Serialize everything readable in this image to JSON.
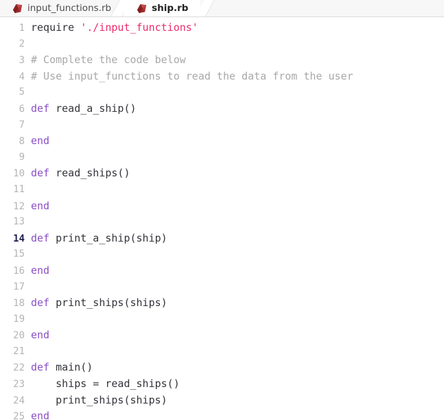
{
  "tabbar": {
    "tabs": [
      {
        "label": "input_functions.rb",
        "icon": "ruby-icon",
        "active": false
      },
      {
        "label": "ship.rb",
        "icon": "ruby-icon",
        "active": true
      }
    ]
  },
  "editor": {
    "language": "ruby",
    "current_line": 14,
    "colors": {
      "keyword": "#8b4fc9",
      "string": "#ec2b6b",
      "comment": "#a8a8a8",
      "text": "#33343a",
      "gutter": "#b4b4b4",
      "background": "#ffffff",
      "tabbar_background": "#f7f7f7",
      "ruby_icon": "#a62b2b"
    },
    "lines": [
      {
        "num": "1",
        "tokens": [
          {
            "t": "require",
            "c": "plain"
          },
          {
            "t": " ",
            "c": "plain"
          },
          {
            "t": "'./input_functions'",
            "c": "str"
          }
        ]
      },
      {
        "num": "2",
        "tokens": []
      },
      {
        "num": "3",
        "tokens": [
          {
            "t": "# Complete the code below",
            "c": "comment"
          }
        ]
      },
      {
        "num": "4",
        "tokens": [
          {
            "t": "# Use input_functions to read the data from the user",
            "c": "comment"
          }
        ]
      },
      {
        "num": "5",
        "tokens": []
      },
      {
        "num": "6",
        "tokens": [
          {
            "t": "def",
            "c": "kw"
          },
          {
            "t": " read_a_ship()",
            "c": "plain"
          }
        ]
      },
      {
        "num": "7",
        "tokens": []
      },
      {
        "num": "8",
        "tokens": [
          {
            "t": "end",
            "c": "kw"
          }
        ]
      },
      {
        "num": "9",
        "tokens": []
      },
      {
        "num": "10",
        "tokens": [
          {
            "t": "def",
            "c": "kw"
          },
          {
            "t": " read_ships()",
            "c": "plain"
          }
        ]
      },
      {
        "num": "11",
        "tokens": []
      },
      {
        "num": "12",
        "tokens": [
          {
            "t": "end",
            "c": "kw"
          }
        ]
      },
      {
        "num": "13",
        "tokens": []
      },
      {
        "num": "14",
        "tokens": [
          {
            "t": "def",
            "c": "kw"
          },
          {
            "t": " print_a_ship(ship)",
            "c": "plain"
          }
        ]
      },
      {
        "num": "15",
        "tokens": []
      },
      {
        "num": "16",
        "tokens": [
          {
            "t": "end",
            "c": "kw"
          }
        ]
      },
      {
        "num": "17",
        "tokens": []
      },
      {
        "num": "18",
        "tokens": [
          {
            "t": "def",
            "c": "kw"
          },
          {
            "t": " print_ships(ships)",
            "c": "plain"
          }
        ]
      },
      {
        "num": "19",
        "tokens": []
      },
      {
        "num": "20",
        "tokens": [
          {
            "t": "end",
            "c": "kw"
          }
        ]
      },
      {
        "num": "21",
        "tokens": []
      },
      {
        "num": "22",
        "tokens": [
          {
            "t": "def",
            "c": "kw"
          },
          {
            "t": " main()",
            "c": "plain"
          }
        ]
      },
      {
        "num": "23",
        "tokens": [
          {
            "t": "    ships = read_ships()",
            "c": "plain"
          }
        ]
      },
      {
        "num": "24",
        "tokens": [
          {
            "t": "    print_ships(ships)",
            "c": "plain"
          }
        ]
      },
      {
        "num": "25",
        "tokens": [
          {
            "t": "end",
            "c": "kw"
          }
        ]
      }
    ]
  }
}
